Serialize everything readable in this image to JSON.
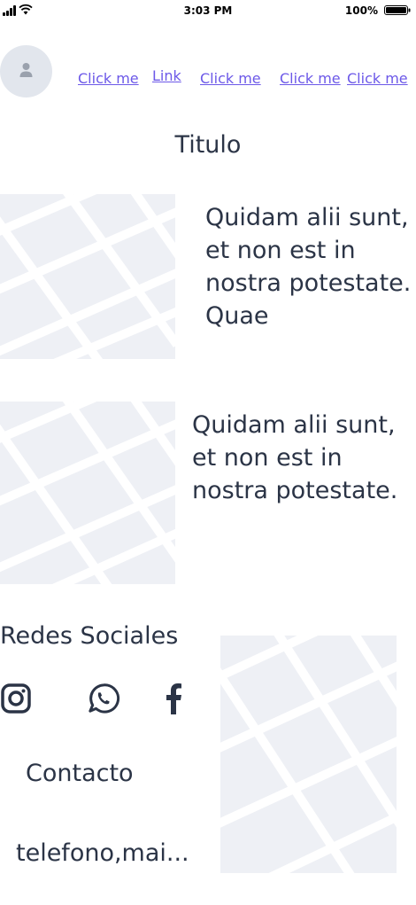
{
  "status_bar": {
    "time": "3:03 PM",
    "battery": "100%"
  },
  "nav": {
    "links": [
      "Click me",
      "Link",
      "Click me",
      "Click me",
      "Click me"
    ]
  },
  "title": "Titulo",
  "sections": [
    {
      "text": "Quidam alii sunt, et non est in nostra potestate. Quae"
    },
    {
      "text": "Quidam alii sunt, et non est in nostra potestate."
    }
  ],
  "social": {
    "title": "Redes Sociales",
    "icons": [
      "instagram-icon",
      "whatsapp-icon",
      "facebook-icon"
    ]
  },
  "contact": {
    "title": "Contacto",
    "info": "telefono,mai..."
  },
  "colors": {
    "link": "#6c58e8",
    "text": "#2b3446",
    "placeholder": "#eef0f5"
  }
}
